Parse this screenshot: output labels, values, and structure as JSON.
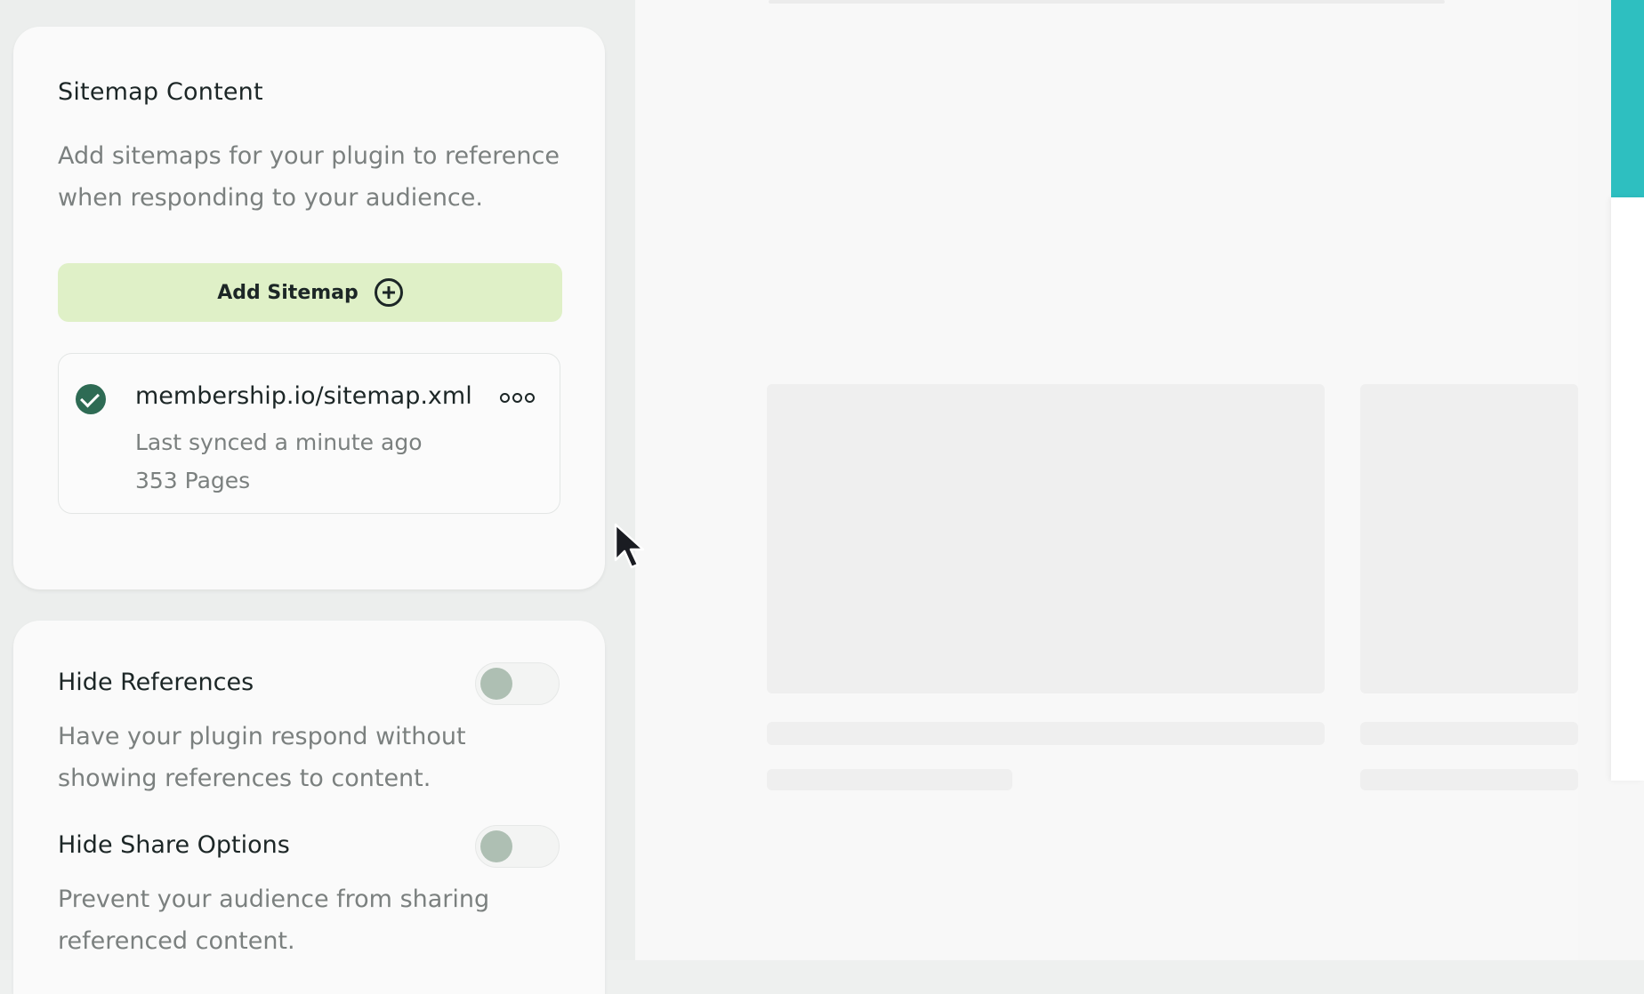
{
  "sitemap_card": {
    "title": "Sitemap Content",
    "description": "Add sitemaps for your plugin to reference when responding to your audience.",
    "add_button_label": "Add Sitemap",
    "items": [
      {
        "url": "membership.io/sitemap.xml",
        "status": "synced",
        "last_synced": "Last synced a minute ago",
        "pages": "353 Pages"
      }
    ]
  },
  "settings_card": {
    "hide_references": {
      "title": "Hide References",
      "description": "Have your plugin respond without showing references to content.",
      "enabled": false
    },
    "hide_share_options": {
      "title": "Hide Share Options",
      "description": "Prevent your audience from sharing referenced content.",
      "enabled": false
    }
  },
  "colors": {
    "accent_button": "#dff0c7",
    "success_check": "#2e6b54",
    "teal_strip": "#2ebfc0",
    "toggle_knob_off": "#aebfb3"
  },
  "icons": {
    "add": "plus-circle-icon",
    "status": "check-circle-icon",
    "menu": "more-horizontal-icon"
  }
}
